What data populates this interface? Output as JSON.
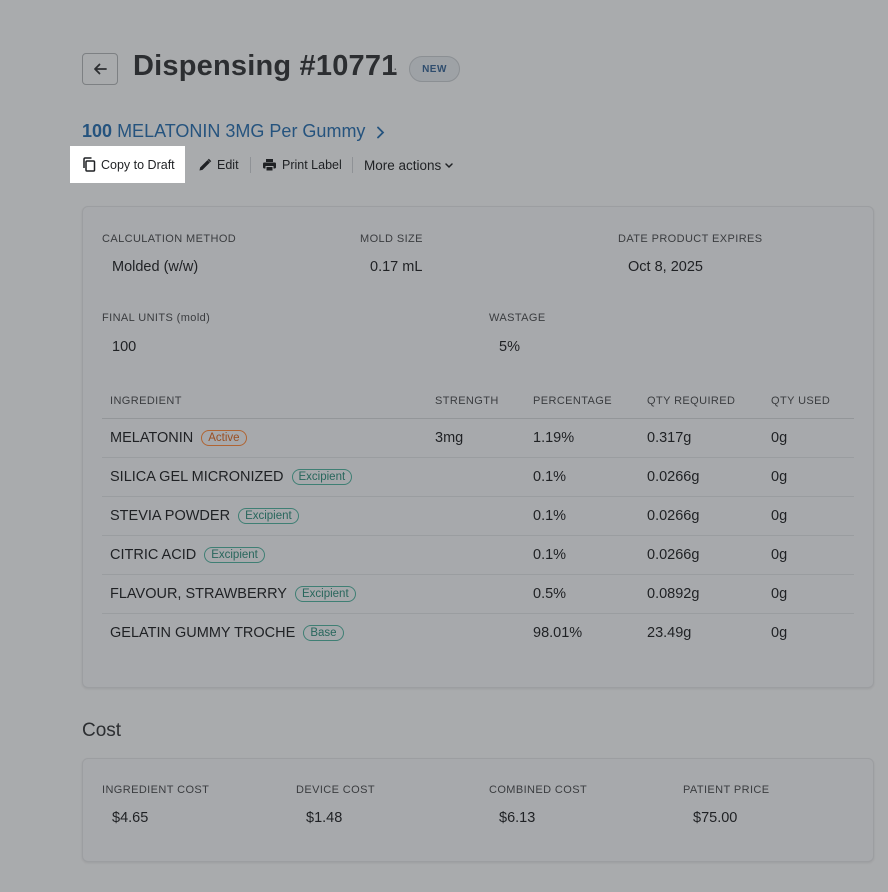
{
  "header": {
    "title": "Dispensing #10771",
    "separator": "·",
    "status": "NEW"
  },
  "product": {
    "quantity": "100",
    "name": "MELATONIN 3MG Per Gummy",
    "chevron": "›"
  },
  "actions": {
    "copy_to_draft": "Copy to Draft",
    "edit": "Edit",
    "print_label": "Print Label",
    "more_actions": "More actions"
  },
  "details": {
    "calculation_method_label": "CALCULATION METHOD",
    "calculation_method": "Molded (w/w)",
    "mold_size_label": "MOLD SIZE",
    "mold_size": "0.17 mL",
    "date_expires_label": "DATE PRODUCT EXPIRES",
    "date_expires": "Oct 8, 2025",
    "final_units_label": "FINAL UNITS (mold)",
    "final_units": "100",
    "wastage_label": "WASTAGE",
    "wastage": "5%"
  },
  "table": {
    "headers": [
      "INGREDIENT",
      "STRENGTH",
      "PERCENTAGE",
      "QTY REQUIRED",
      "QTY USED"
    ],
    "rows": [
      {
        "name": "MELATONIN",
        "tag": "Active",
        "strength": "3mg",
        "percentage": "1.19%",
        "qty_required": "0.317g",
        "qty_used": "0g"
      },
      {
        "name": "SILICA GEL MICRONIZED",
        "tag": "Excipient",
        "strength": "",
        "percentage": "0.1%",
        "qty_required": "0.0266g",
        "qty_used": "0g"
      },
      {
        "name": "STEVIA POWDER",
        "tag": "Excipient",
        "strength": "",
        "percentage": "0.1%",
        "qty_required": "0.0266g",
        "qty_used": "0g"
      },
      {
        "name": "CITRIC ACID",
        "tag": "Excipient",
        "strength": "",
        "percentage": "0.1%",
        "qty_required": "0.0266g",
        "qty_used": "0g"
      },
      {
        "name": "FLAVOUR, STRAWBERRY",
        "tag": "Excipient",
        "strength": "",
        "percentage": "0.5%",
        "qty_required": "0.0892g",
        "qty_used": "0g"
      },
      {
        "name": "GELATIN GUMMY TROCHE",
        "tag": "Base",
        "strength": "",
        "percentage": "98.01%",
        "qty_required": "23.49g",
        "qty_used": "0g"
      }
    ]
  },
  "cost": {
    "title": "Cost",
    "ingredient_cost_label": "INGREDIENT COST",
    "ingredient_cost": "$4.65",
    "device_cost_label": "DEVICE COST",
    "device_cost": "$1.48",
    "combined_cost_label": "COMBINED COST",
    "combined_cost": "$6.13",
    "patient_price_label": "PATIENT PRICE",
    "patient_price": "$75.00"
  },
  "colors": {
    "overlay": "#a9abad",
    "link": "#25537e",
    "active_tag": "#b06432",
    "excipient_tag": "#3f7f74"
  }
}
